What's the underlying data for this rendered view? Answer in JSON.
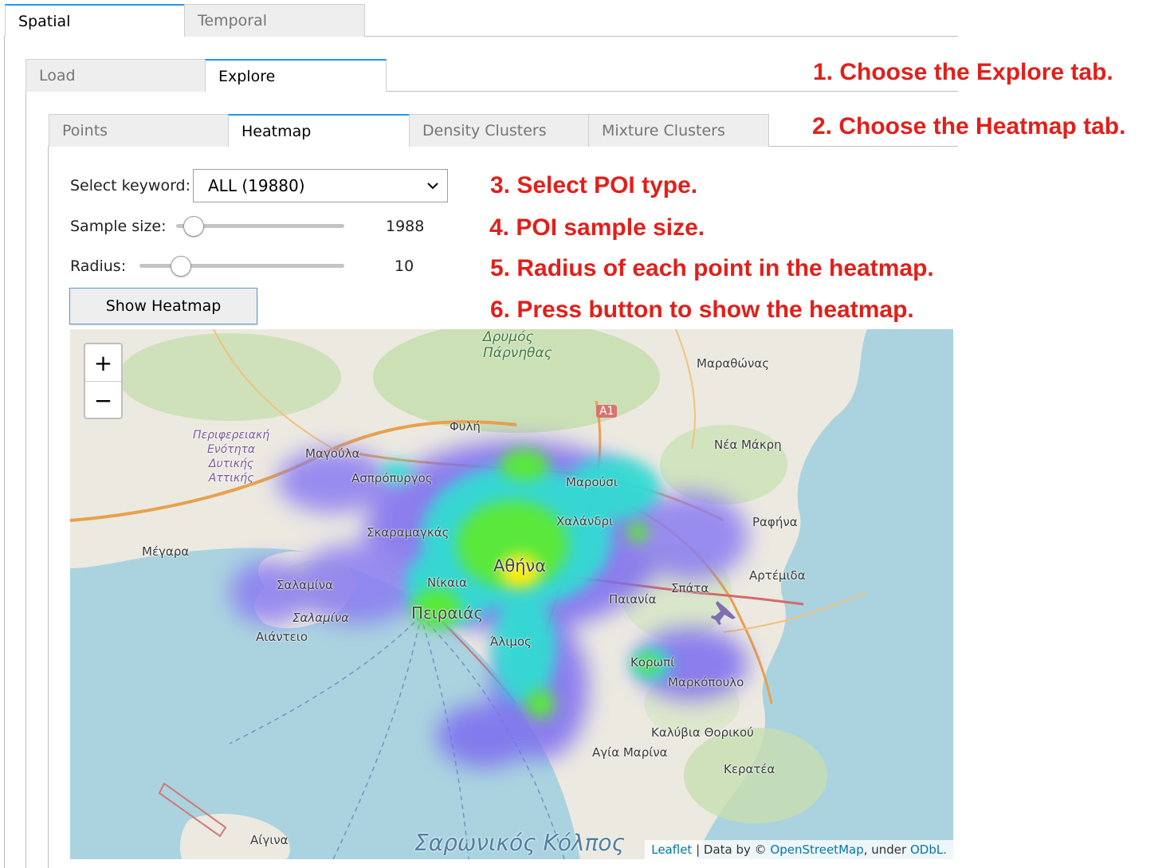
{
  "outer_tabs": [
    {
      "label": "Spatial",
      "active": true
    },
    {
      "label": "Temporal",
      "active": false
    }
  ],
  "mid_tabs": [
    {
      "label": "Load",
      "active": false
    },
    {
      "label": "Explore",
      "active": true
    }
  ],
  "inner_tabs": [
    {
      "label": "Points",
      "active": false
    },
    {
      "label": "Heatmap",
      "active": true
    },
    {
      "label": "Density Clusters",
      "active": false
    },
    {
      "label": "Mixture Clusters",
      "active": false
    }
  ],
  "controls": {
    "keyword_label": "Select keyword:",
    "keyword_value": "ALL (19880)",
    "sample_label": "Sample size:",
    "sample_value": "1988",
    "sample_fraction": 0.1,
    "radius_label": "Radius:",
    "radius_value": "10",
    "radius_fraction": 0.2,
    "show_button": "Show Heatmap"
  },
  "annotations": [
    "1. Choose the Explore tab.",
    "2. Choose the Heatmap tab.",
    "3. Select POI type.",
    "4. POI sample size.",
    "5. Radius of each point in the heatmap.",
    "6. Press button to show the heatmap."
  ],
  "map": {
    "zoom_in": "+",
    "zoom_out": "−",
    "labels": {
      "parnitha": "Δρυμός\nΠάρνηθας",
      "marathonas": "Μαραθώνας",
      "a1": "A1",
      "fyli": "Φυλή",
      "nea_makri": "Νέα Μάκρη",
      "perifereiaki": "Περιφερειακή\nΕνότητα\nΔυτικής\nΑττικής",
      "magoula": "Μαγούλα",
      "aspropyrgos": "Ασπρόπυργος",
      "marousi": "Μαρούσι",
      "skaramagkas": "Σκαραμαγκάς",
      "chalandri": "Χαλάνδρι",
      "rafina": "Ραφήνα",
      "megara": "Μέγαρα",
      "athina": "Αθήνα",
      "artemida": "Αρτέμιδα",
      "salamina1": "Σαλαμίνα",
      "nikaia": "Νίκαια",
      "spata": "Σπάτα",
      "paiania": "Παιανία",
      "salamina2": "Σαλαμίνα",
      "peiraias": "Πειραιάς",
      "aiantio": "Αιάντειο",
      "alimos": "Άλιμος",
      "koropi": "Κορωπί",
      "markopoulo": "Μαρκόπουλο",
      "kalyvia": "Καλύβια Θορικού",
      "agia_marina": "Αγία Μαρίνα",
      "keratea": "Κερατέα",
      "aigina": "Αίγινα",
      "saronikos": "Σαρωνικός Κόλπος"
    },
    "attribution": {
      "leaflet": "Leaflet",
      "sep1": " | Data by © ",
      "osm": "OpenStreetMap",
      "sep2": ", under ",
      "odbl": "ODbL."
    },
    "colors": {
      "sea": "#aad3df",
      "land": "#eceae3",
      "forest": "#c8dfb0",
      "heat_low": "#7b6cf0",
      "heat_mid": "#2fe0d2",
      "heat_high": "#5ae83a",
      "heat_peak": "#ffee00"
    }
  }
}
